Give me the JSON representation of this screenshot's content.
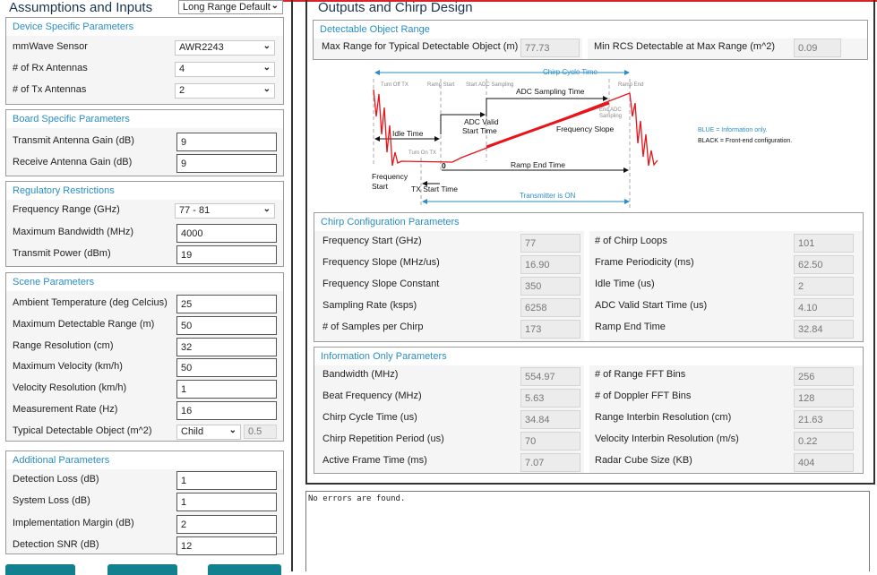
{
  "colors": {
    "accent": "#2a8ec4",
    "button": "#12808f",
    "ramp": "#e8141a"
  },
  "left": {
    "title": "Assumptions and Inputs",
    "preset": "Long Range Default",
    "device": {
      "header": "Device Specific Parameters",
      "rows": [
        {
          "label": "mmWave Sensor",
          "value": "AWR2243",
          "type": "select"
        },
        {
          "label": "# of Rx Antennas",
          "value": "4",
          "type": "select"
        },
        {
          "label": "# of Tx Antennas",
          "value": "2",
          "type": "select"
        }
      ]
    },
    "board": {
      "header": "Board Specific Parameters",
      "rows": [
        {
          "label": "Transmit Antenna Gain (dB)",
          "value": "9",
          "type": "input"
        },
        {
          "label": "Receive Antenna Gain (dB)",
          "value": "9",
          "type": "input"
        }
      ]
    },
    "regulatory": {
      "header": "Regulatory Restrictions",
      "rows": [
        {
          "label": "Frequency Range (GHz)",
          "value": "77 - 81",
          "type": "select"
        },
        {
          "label": "Maximum Bandwidth (MHz)",
          "value": "4000",
          "type": "input"
        },
        {
          "label": "Transmit Power (dBm)",
          "value": "19",
          "type": "input"
        }
      ]
    },
    "scene": {
      "header": "Scene Parameters",
      "rows": [
        {
          "label": "Ambient Temperature (deg Celcius)",
          "value": "25",
          "type": "input"
        },
        {
          "label": "Maximum Detectable Range (m)",
          "value": "50",
          "type": "input"
        },
        {
          "label": "Range Resolution (cm)",
          "value": "32",
          "type": "input"
        },
        {
          "label": "Maximum Velocity (km/h)",
          "value": "50",
          "type": "input"
        },
        {
          "label": "Velocity Resolution (km/h)",
          "value": "1",
          "type": "input"
        },
        {
          "label": "Measurement Rate (Hz)",
          "value": "16",
          "type": "input"
        },
        {
          "label": "Typical Detectable Object (m^2)",
          "value": "Child",
          "extra": "0.5",
          "type": "object"
        }
      ]
    },
    "additional": {
      "header": "Additional Parameters",
      "rows": [
        {
          "label": "Detection Loss (dB)",
          "value": "1",
          "type": "input"
        },
        {
          "label": "System Loss (dB)",
          "value": "1",
          "type": "input"
        },
        {
          "label": "Implementation Margin (dB)",
          "value": "2",
          "type": "input"
        },
        {
          "label": "Detection SNR (dB)",
          "value": "12",
          "type": "input"
        }
      ]
    }
  },
  "right": {
    "title": "Outputs and Chirp Design",
    "detectable": {
      "header": "Detectable Object Range",
      "left": {
        "label": "Max Range for Typical Detectable Object (m)",
        "value": "77.73"
      },
      "right": {
        "label": "Min RCS Detectable at Max Range (m^2)",
        "value": "0.09"
      }
    },
    "diagram": {
      "chirp_cycle": "Chirp Cycle Time",
      "turn_off_tx": "Turn Off TX",
      "ramp_start": "Ramp Start",
      "start_adc": "Start ADC Sampling",
      "ramp_end": "Ramp End",
      "adc_sampling_time": "ADC Sampling Time",
      "end_adc_1": "End ADC",
      "end_adc_2": "Sampling",
      "adc_valid_1": "ADC Valid",
      "adc_valid_2": "Start Time",
      "idle_time": "Idle Time",
      "freq_slope": "Frequency Slope",
      "turn_on_tx": "Turn On TX",
      "zero": "0",
      "ramp_end_time": "Ramp End Time",
      "freq_start_1": "Frequency",
      "freq_start_2": "Start",
      "tx_start_time": "TX Start Time",
      "tx_on": "Transmitter is ON",
      "legend_blue": "BLUE = Information only.",
      "legend_black": "BLACK = Front-end configuration."
    },
    "chirp": {
      "header": "Chirp Configuration Parameters",
      "left": [
        {
          "label": "Frequency Start (GHz)",
          "value": "77"
        },
        {
          "label": "Frequency Slope (MHz/us)",
          "value": "16.90"
        },
        {
          "label": "Frequency Slope Constant",
          "value": "350"
        },
        {
          "label": "Sampling Rate (ksps)",
          "value": "6258"
        },
        {
          "label": "# of Samples per Chirp",
          "value": "173"
        }
      ],
      "right": [
        {
          "label": "# of Chirp Loops",
          "value": "101"
        },
        {
          "label": "Frame Periodicity (ms)",
          "value": "62.50"
        },
        {
          "label": "Idle Time (us)",
          "value": "2"
        },
        {
          "label": "ADC Valid Start Time (us)",
          "value": "4.10"
        },
        {
          "label": "Ramp End Time",
          "value": "32.84"
        }
      ]
    },
    "info": {
      "header": "Information Only Parameters",
      "left": [
        {
          "label": "Bandwidth (MHz)",
          "value": "554.97"
        },
        {
          "label": "Beat Frequency (MHz)",
          "value": "5.63"
        },
        {
          "label": "Chirp Cycle Time (us)",
          "value": "34.84"
        },
        {
          "label": "Chirp Repetition Period (us)",
          "value": "70"
        },
        {
          "label": "Active Frame Time (ms)",
          "value": "7.07"
        }
      ],
      "right": [
        {
          "label": "# of Range FFT Bins",
          "value": "256"
        },
        {
          "label": "# of Doppler FFT Bins",
          "value": "128"
        },
        {
          "label": "Range Interbin Resolution (cm)",
          "value": "21.63"
        },
        {
          "label": "Velocity Interbin Resolution (m/s)",
          "value": "0.22"
        },
        {
          "label": "Radar Cube Size (KB)",
          "value": "404"
        }
      ]
    },
    "errors": "No errors are found."
  }
}
